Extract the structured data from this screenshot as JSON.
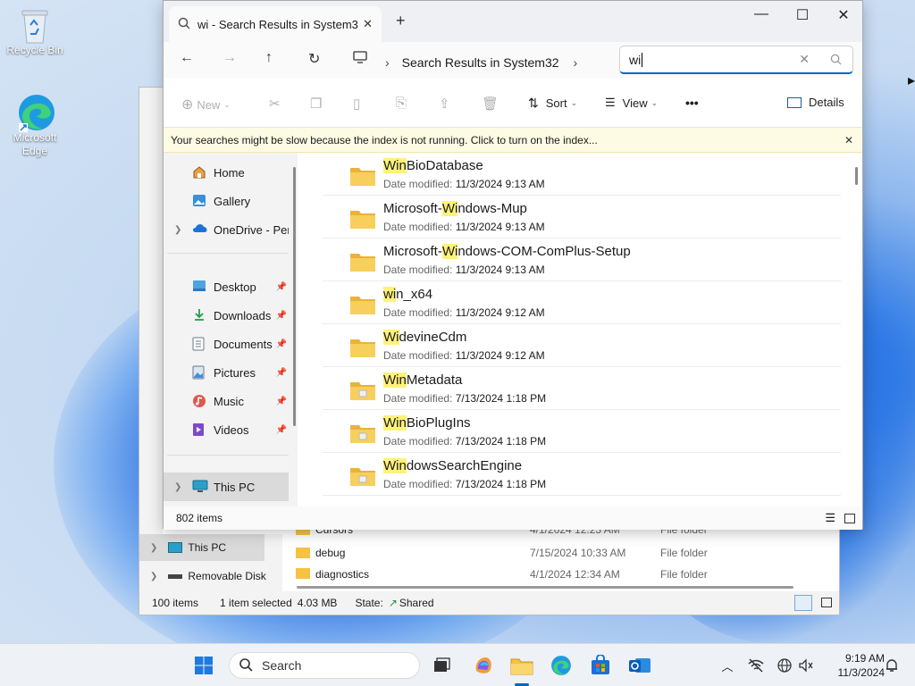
{
  "desktop": {
    "icons": [
      {
        "label": "Recycle Bin"
      },
      {
        "label": "Microsoft Edge"
      }
    ]
  },
  "back_window": {
    "nav": {
      "this_pc": "This PC",
      "removable": "Removable Disk"
    },
    "rows": [
      {
        "name": "Cursors",
        "date": "4/1/2024 12:23 AM",
        "type": "File folder"
      },
      {
        "name": "debug",
        "date": "7/15/2024 10:33 AM",
        "type": "File folder"
      },
      {
        "name": "diagnostics",
        "date": "4/1/2024 12:34 AM",
        "type": "File folder"
      }
    ],
    "status": {
      "items": "100 items",
      "selected": "1 item selected",
      "size": "4.03 MB",
      "state_label": "State:",
      "state_value": "Shared"
    }
  },
  "window": {
    "tab_title": "wi - Search Results in System3",
    "new_tab": "+",
    "controls": {
      "minimize": "—",
      "maximize": "☐",
      "close": "✕"
    },
    "breadcrumb": "Search Results in System32",
    "search_value": "wi",
    "toolbar": {
      "new": "New",
      "sort": "Sort",
      "view": "View",
      "more": "•••",
      "details": "Details"
    },
    "info_message": "Your searches might be slow because the index is not running.  Click to turn on the index...",
    "info_close": "✕",
    "nav": {
      "home": "Home",
      "gallery": "Gallery",
      "onedrive": "OneDrive - Perso",
      "desktop": "Desktop",
      "downloads": "Downloads",
      "documents": "Documents",
      "pictures": "Pictures",
      "music": "Music",
      "videos": "Videos",
      "this_pc": "This PC"
    },
    "date_label": "Date modified:",
    "results": [
      {
        "pre": "",
        "hl": "Win",
        "post": "BioDatabase",
        "date": "11/3/2024 9:13 AM",
        "system": false
      },
      {
        "pre": "Microsoft-",
        "hl": "Wi",
        "post": "ndows-Mup",
        "date": "11/3/2024 9:13 AM",
        "system": false
      },
      {
        "pre": "Microsoft-",
        "hl": "Wi",
        "post": "ndows-COM-ComPlus-Setup",
        "date": "11/3/2024 9:13 AM",
        "system": false
      },
      {
        "pre": "",
        "hl": "wi",
        "post": "n_x64",
        "date": "11/3/2024 9:12 AM",
        "system": false
      },
      {
        "pre": "",
        "hl": "Wi",
        "post": "devineCdm",
        "date": "11/3/2024 9:12 AM",
        "system": false
      },
      {
        "pre": "",
        "hl": "Win",
        "post": "Metadata",
        "date": "7/13/2024 1:18 PM",
        "system": true
      },
      {
        "pre": "",
        "hl": "Win",
        "post": "BioPlugIns",
        "date": "7/13/2024 1:18 PM",
        "system": true
      },
      {
        "pre": "",
        "hl": "Win",
        "post": "dowsSearchEngine",
        "date": "7/13/2024 1:18 PM",
        "system": true
      }
    ],
    "status": {
      "count": "802 items"
    }
  },
  "taskbar": {
    "search_label": "Search",
    "time": "9:19 AM",
    "date": "11/3/2024"
  },
  "colors": {
    "accent": "#0067c0",
    "highlight": "#fff27a",
    "folder": "#f5c242"
  }
}
